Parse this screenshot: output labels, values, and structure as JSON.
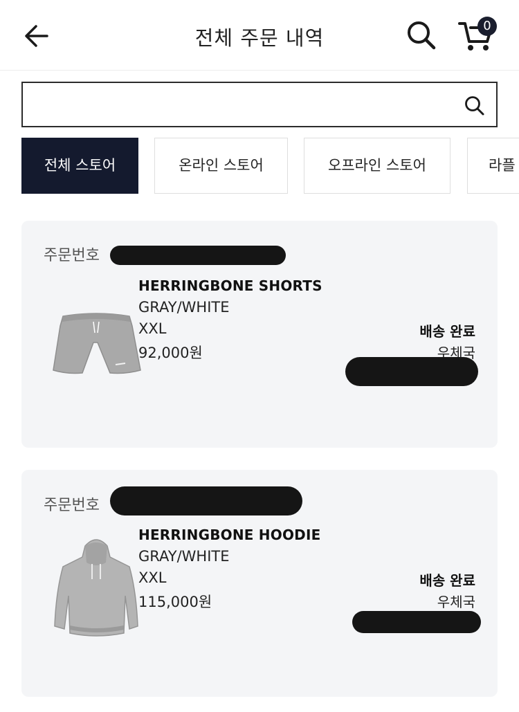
{
  "header": {
    "title": "전체 주문 내역",
    "cart_count": "0"
  },
  "search": {
    "placeholder": ""
  },
  "tabs": [
    {
      "label": "전체 스토어",
      "active": true
    },
    {
      "label": "온라인 스토어",
      "active": false
    },
    {
      "label": "오프라인 스토어",
      "active": false
    },
    {
      "label": "라플",
      "active": false
    }
  ],
  "orders": [
    {
      "order_label": "주문번호",
      "product_name": "HERRINGBONE SHORTS",
      "color": "GRAY/WHITE",
      "size": "XXL",
      "price": "92,000원",
      "status": "배송 완료",
      "carrier": "우체국"
    },
    {
      "order_label": "주문번호",
      "product_name": "HERRINGBONE HOODIE",
      "color": "GRAY/WHITE",
      "size": "XXL",
      "price": "115,000원",
      "status": "배송 완료",
      "carrier": "우체국"
    }
  ],
  "colors": {
    "active_tab": "#141a2e",
    "card_bg": "#f4f5f7"
  }
}
